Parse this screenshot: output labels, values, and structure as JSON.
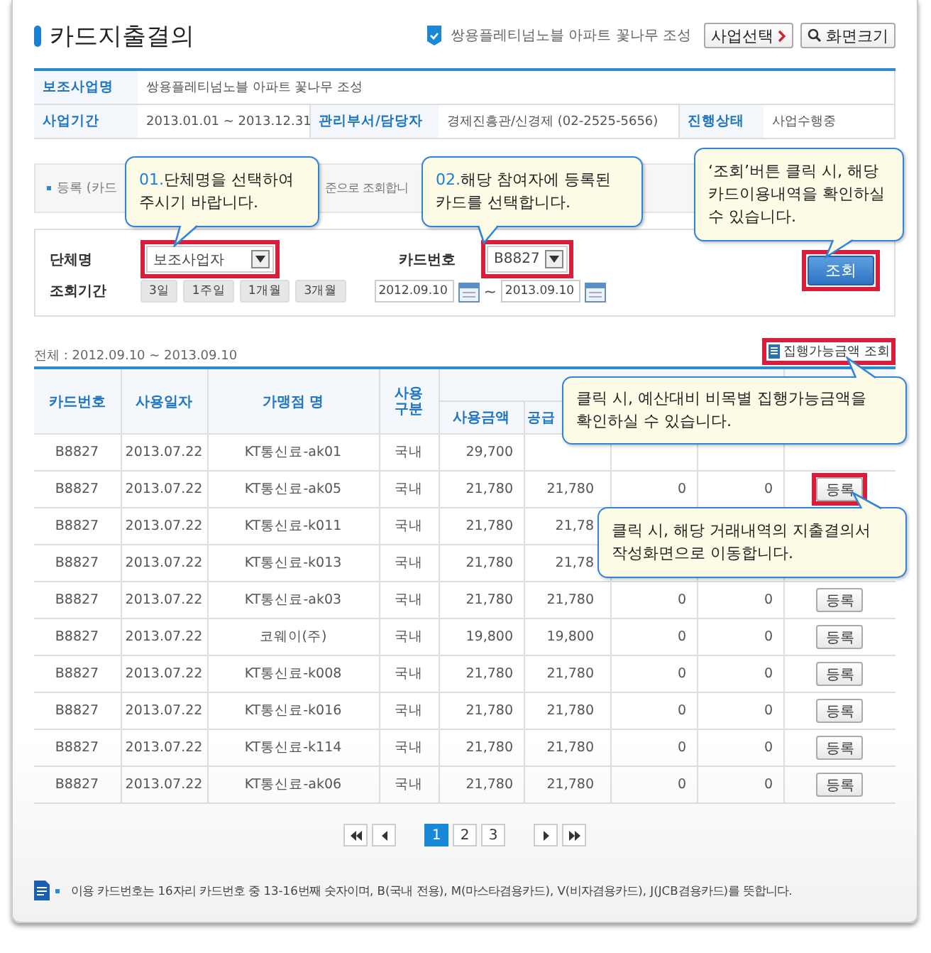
{
  "page_title": "카드지출결의",
  "project_badge": "쌍용플레티넘노블 아파트 꽃나무 조성",
  "header_buttons": [
    {
      "label": "사업선택",
      "kind": "select"
    },
    {
      "label": "화면크기",
      "kind": "zoom"
    }
  ],
  "info": {
    "rows": [
      [
        {
          "label": "보조사업명",
          "value": "쌍용플레티넘노블 아파트 꽃나무 조성"
        }
      ],
      [
        {
          "label": "사업기간",
          "value": "2013.01.01 ~ 2013.12.31"
        },
        {
          "label": "관리부서/담당자",
          "value": "경제진흥관/신경제 (02-2525-5656)"
        },
        {
          "label": "진행상태",
          "value": "사업수행중"
        }
      ]
    ]
  },
  "notice": {
    "left": "등록 (카드",
    "right": "준으로 조회합니"
  },
  "search": {
    "org": {
      "label": "단체명",
      "value": "보조사업자",
      "highlighted": true
    },
    "card": {
      "label": "카드번호",
      "value": "B8827",
      "highlighted": true
    },
    "period_label": "조회기간",
    "period_buttons": [
      "3일",
      "1주일",
      "1개월",
      "3개월"
    ],
    "date_from": "2012.09.10",
    "date_sep": "~",
    "date_to": "2013.09.10",
    "submit": {
      "label": "조회",
      "highlighted": true
    }
  },
  "total_text": "전체 : 2012.09.10 ~ 2013.09.10",
  "budget_link": {
    "label": "집행가능금액 조회",
    "highlighted": true
  },
  "table": {
    "columns": [
      "카드번호",
      "사용일자",
      "가맹점 명",
      "사용구분"
    ],
    "sub_columns": [
      "사용금액",
      "공급"
    ],
    "rows": [
      {
        "card": "B8827",
        "date": "2013.07.22",
        "merchant": "KT통신료-ak01",
        "usage": "국내",
        "amount": "29,700"
      },
      {
        "card": "B8827",
        "date": "2013.07.22",
        "merchant": "KT통신료-ak05",
        "usage": "국내",
        "amount": "21,780",
        "supply": "21,780",
        "col7": "0",
        "col8": "0",
        "action": {
          "label": "등록",
          "highlighted": true
        }
      },
      {
        "card": "B8827",
        "date": "2013.07.22",
        "merchant": "KT통신료-k011",
        "usage": "국내",
        "amount": "21,780",
        "supply": "21,78"
      },
      {
        "card": "B8827",
        "date": "2013.07.22",
        "merchant": "KT통신료-k013",
        "usage": "국내",
        "amount": "21,780",
        "supply": "21,78"
      },
      {
        "card": "B8827",
        "date": "2013.07.22",
        "merchant": "KT통신료-ak03",
        "usage": "국내",
        "amount": "21,780",
        "supply": "21,780",
        "col7": "0",
        "col8": "0",
        "action": {
          "label": "등록",
          "highlighted": false
        }
      },
      {
        "card": "B8827",
        "date": "2013.07.22",
        "merchant": "코웨이(주)",
        "usage": "국내",
        "amount": "19,800",
        "supply": "19,800",
        "col7": "0",
        "col8": "0",
        "action": {
          "label": "등록",
          "highlighted": false
        }
      },
      {
        "card": "B8827",
        "date": "2013.07.22",
        "merchant": "KT통신료-k008",
        "usage": "국내",
        "amount": "21,780",
        "supply": "21,780",
        "col7": "0",
        "col8": "0",
        "action": {
          "label": "등록",
          "highlighted": false
        }
      },
      {
        "card": "B8827",
        "date": "2013.07.22",
        "merchant": "KT통신료-k016",
        "usage": "국내",
        "amount": "21,780",
        "supply": "21,780",
        "col7": "0",
        "col8": "0",
        "action": {
          "label": "등록",
          "highlighted": false
        }
      },
      {
        "card": "B8827",
        "date": "2013.07.22",
        "merchant": "KT통신료-k114",
        "usage": "국내",
        "amount": "21,780",
        "supply": "21,780",
        "col7": "0",
        "col8": "0",
        "action": {
          "label": "등록",
          "highlighted": false
        }
      },
      {
        "card": "B8827",
        "date": "2013.07.22",
        "merchant": "KT통신료-ak06",
        "usage": "국내",
        "amount": "21,780",
        "supply": "21,780",
        "col7": "0",
        "col8": "0",
        "action": {
          "label": "등록",
          "highlighted": false
        }
      }
    ]
  },
  "pagination": {
    "pages": [
      {
        "label": "1",
        "selected": true
      },
      {
        "label": "2",
        "selected": false
      },
      {
        "label": "3",
        "selected": false
      }
    ]
  },
  "footnote": "이용 카드번호는 16자리 카드번호 중 13-16번째 숫자이며, B(국내 전용), M(마스타겸용카드), V(비자겸용카드), J(JCB겸용카드)를 뜻합니다.",
  "callouts": [
    {
      "number": "01.",
      "lines": [
        "단체명을 선택하여",
        "주시기 바랍니다."
      ]
    },
    {
      "number": "02.",
      "lines": [
        "해당 참여자에 등록된",
        "카드를 선택합니다."
      ]
    },
    {
      "lines": [
        "‘조회’버튼 클릭 시, 해당",
        "카드이용내역을 확인하실",
        "수 있습니다."
      ]
    },
    {
      "lines": [
        "클릭 시, 예산대비 비목별 집행가능금액을",
        "확인하실 수 있습니다."
      ]
    },
    {
      "lines": [
        "클릭 시, 해당 거래내역의 지출결의서",
        "작성화면으로 이동합니다."
      ]
    }
  ]
}
